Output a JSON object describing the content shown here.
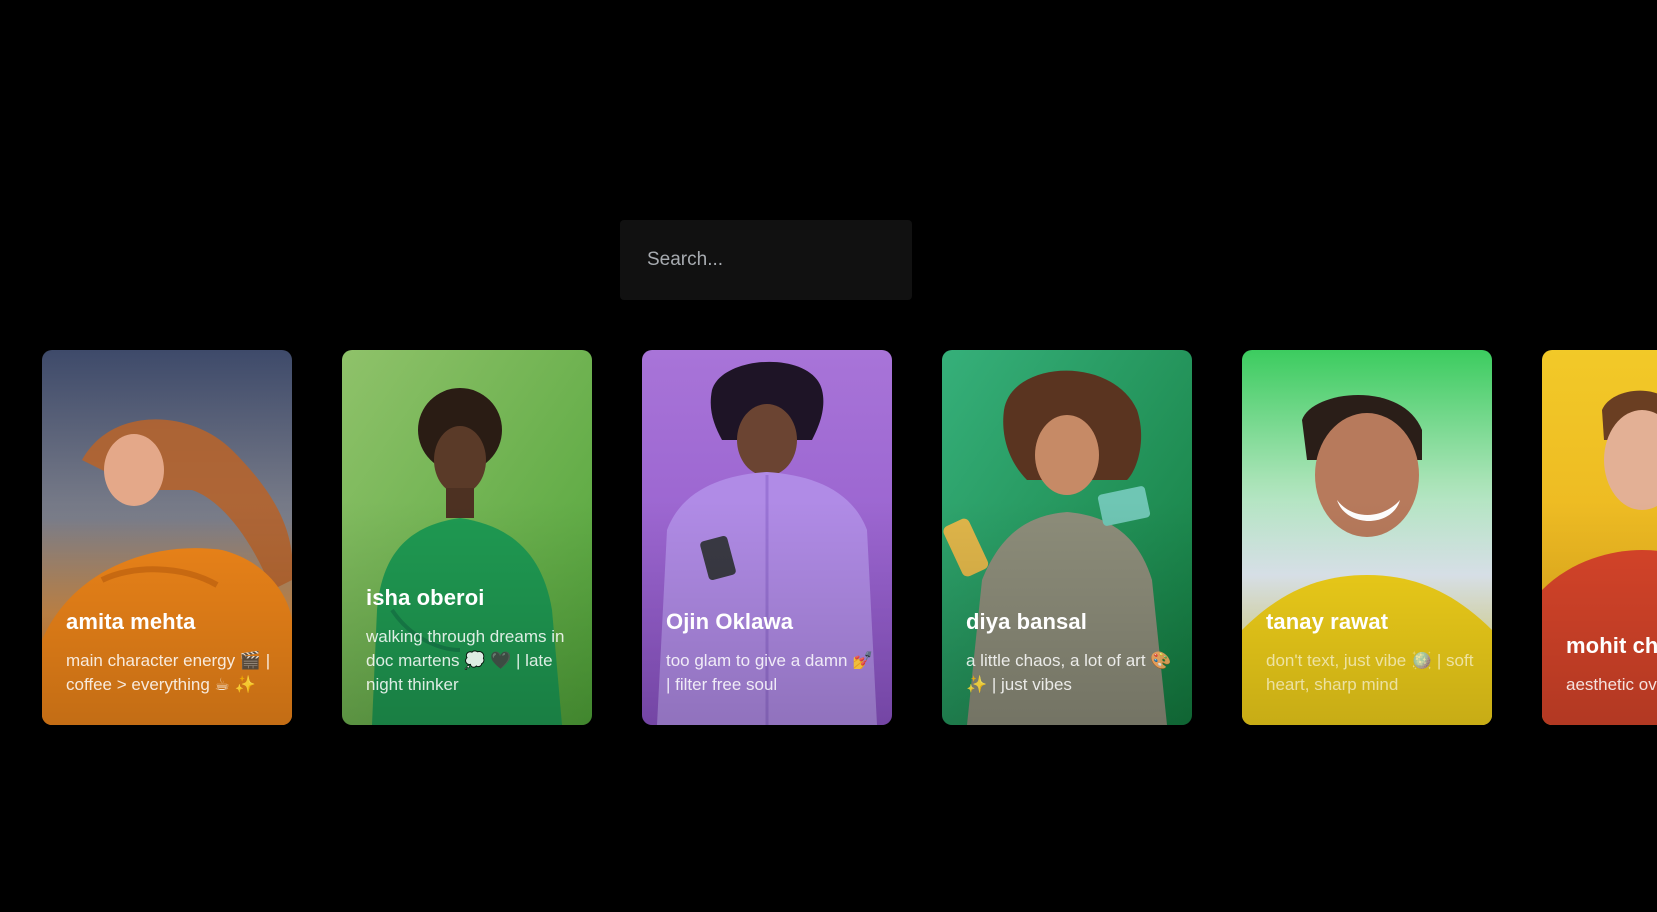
{
  "search": {
    "placeholder": "Search..."
  },
  "colors": {
    "background": "#000000",
    "search_background": "#111111"
  },
  "profiles": [
    {
      "name": "amita mehta",
      "bio": "main character energy 🎬 | coffee > everything ☕ ✨",
      "theme": "orange"
    },
    {
      "name": "isha oberoi",
      "bio": "walking through dreams in doc martens 💭 🖤 | late night thinker",
      "theme": "green"
    },
    {
      "name": "Ojin Oklawa",
      "bio": "too glam to give a damn 💅 | filter free soul",
      "theme": "purple"
    },
    {
      "name": "diya bansal",
      "bio": "a little chaos, a lot of art 🎨 ✨ | just vibes",
      "theme": "teal"
    },
    {
      "name": "tanay rawat",
      "bio": "don't text, just vibe 🪩 | soft heart, sharp mind",
      "theme": "yellow-green"
    },
    {
      "name": "mohit ch",
      "bio": "aesthetic ov living in low",
      "theme": "yellow-red"
    }
  ]
}
